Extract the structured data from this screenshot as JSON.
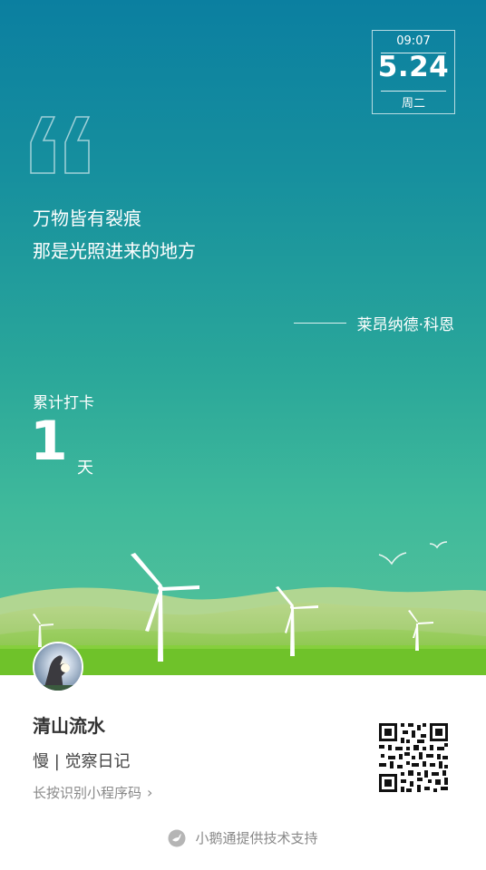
{
  "date": {
    "time": "09:07",
    "day": "5.24",
    "weekday": "周二"
  },
  "quote": {
    "line1": "万物皆有裂痕",
    "line2": "那是光照进来的地方",
    "author": "莱昂纳德·科恩"
  },
  "checkin": {
    "label": "累计打卡",
    "count": "1",
    "unit": "天"
  },
  "user": {
    "name": "清山流水",
    "subtitle": "慢 | 觉察日记"
  },
  "miniprogram": {
    "hint": "长按识别小程序码"
  },
  "footer": {
    "text": "小鹅通提供技术支持"
  },
  "colors": {
    "sky_top": "#0b7fa0",
    "sky_bottom": "#58c49a",
    "grass": "#6fc22a",
    "text_dark": "#333333",
    "text_muted": "#888888"
  }
}
